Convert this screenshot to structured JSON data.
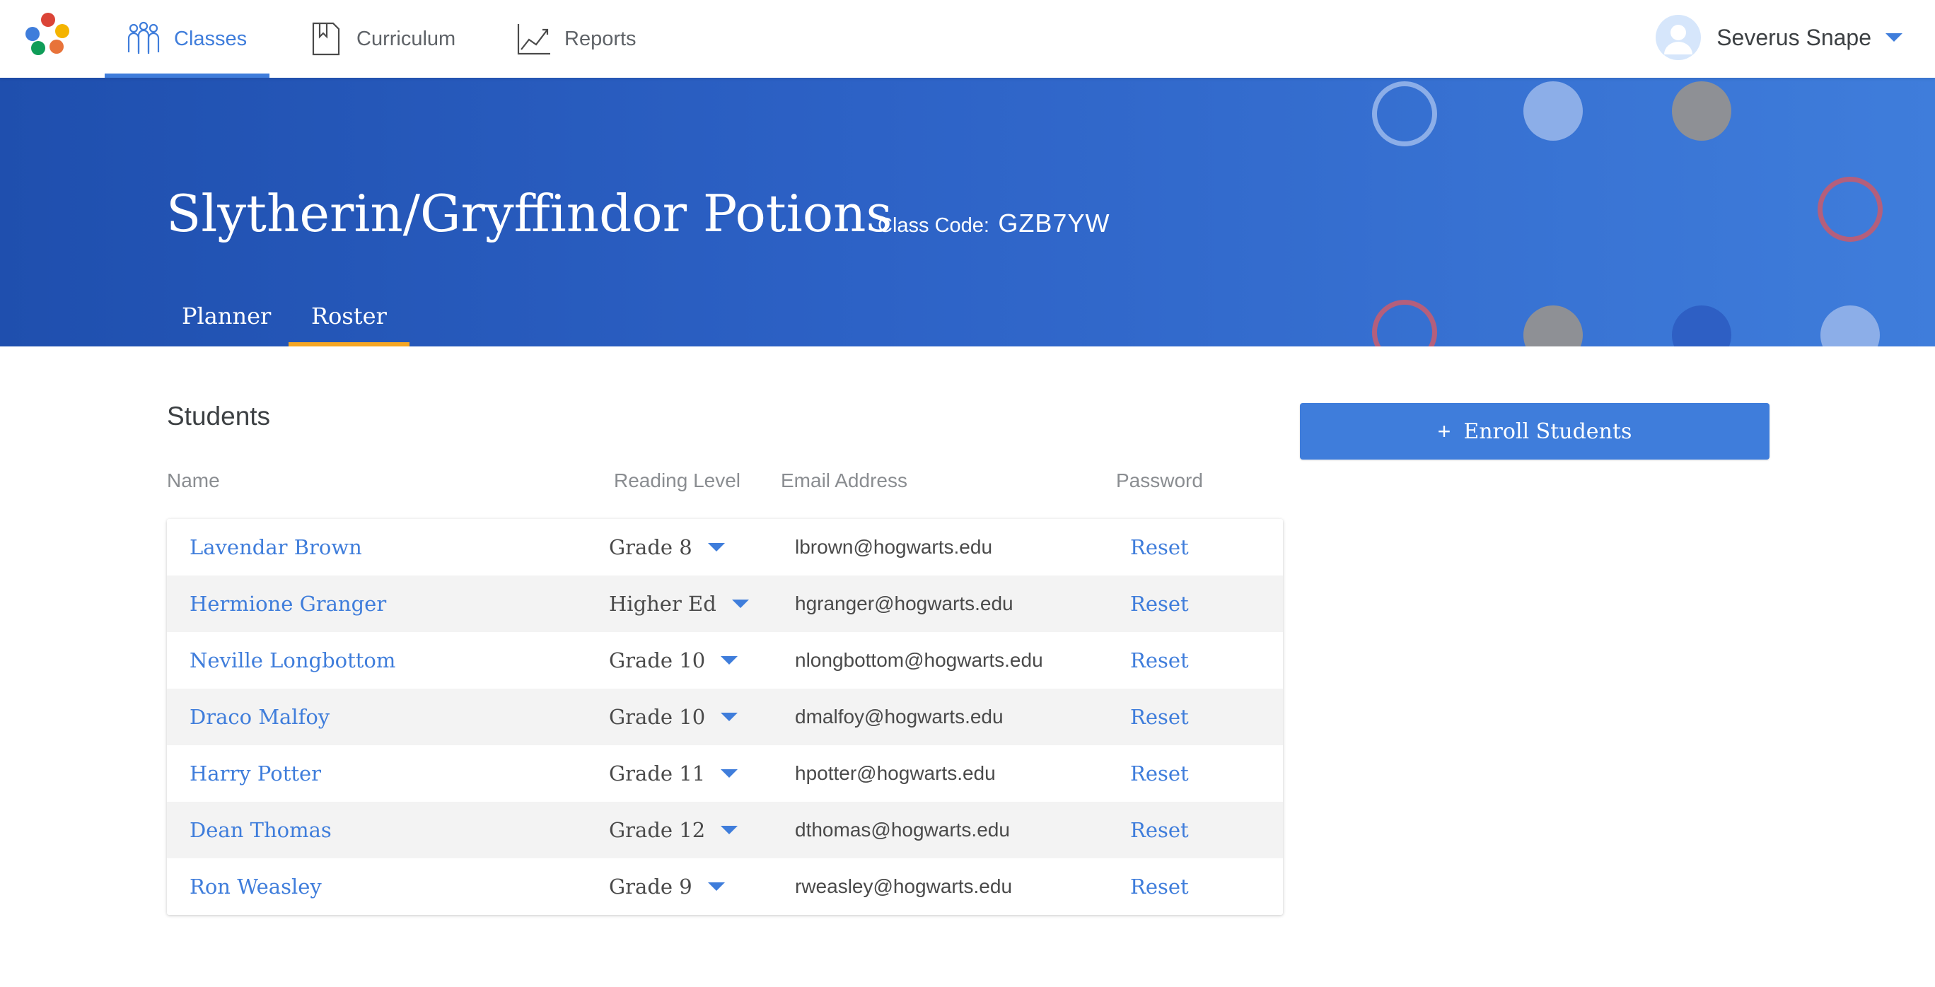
{
  "nav": {
    "items": [
      {
        "label": "Classes",
        "icon": "people-icon",
        "active": true
      },
      {
        "label": "Curriculum",
        "icon": "book-icon",
        "active": false
      },
      {
        "label": "Reports",
        "icon": "line-chart-icon",
        "active": false
      }
    ],
    "user_name": "Severus Snape"
  },
  "class": {
    "title": "Slytherin/Gryffindor Potions",
    "code_label": "Class Code:",
    "code_value": "GZB7YW",
    "tabs": [
      {
        "label": "Planner",
        "active": false
      },
      {
        "label": "Roster",
        "active": true
      }
    ]
  },
  "roster": {
    "section_title": "Students",
    "columns": {
      "name": "Name",
      "reading_level": "Reading Level",
      "email": "Email Address",
      "password": "Password"
    },
    "students": [
      {
        "name": "Lavendar Brown",
        "level": "Grade 8",
        "email": "lbrown@hogwarts.edu",
        "password_action": "Reset"
      },
      {
        "name": "Hermione Granger",
        "level": "Higher Ed",
        "email": "hgranger@hogwarts.edu",
        "password_action": "Reset"
      },
      {
        "name": "Neville Longbottom",
        "level": "Grade 10",
        "email": "nlongbottom@hogwarts.edu",
        "password_action": "Reset"
      },
      {
        "name": "Draco Malfoy",
        "level": "Grade 10",
        "email": "dmalfoy@hogwarts.edu",
        "password_action": "Reset"
      },
      {
        "name": "Harry Potter",
        "level": "Grade 11",
        "email": "hpotter@hogwarts.edu",
        "password_action": "Reset"
      },
      {
        "name": "Dean Thomas",
        "level": "Grade 12",
        "email": "dthomas@hogwarts.edu",
        "password_action": "Reset"
      },
      {
        "name": "Ron Weasley",
        "level": "Grade 9",
        "email": "rweasley@hogwarts.edu",
        "password_action": "Reset"
      }
    ],
    "enroll_button": {
      "icon": "+",
      "label": "Enroll Students"
    }
  },
  "colors": {
    "accent": "#3f7ddb",
    "hero_start": "#1f4fae",
    "hero_end": "#3f7ddb",
    "tab_underline": "#f5a623"
  }
}
